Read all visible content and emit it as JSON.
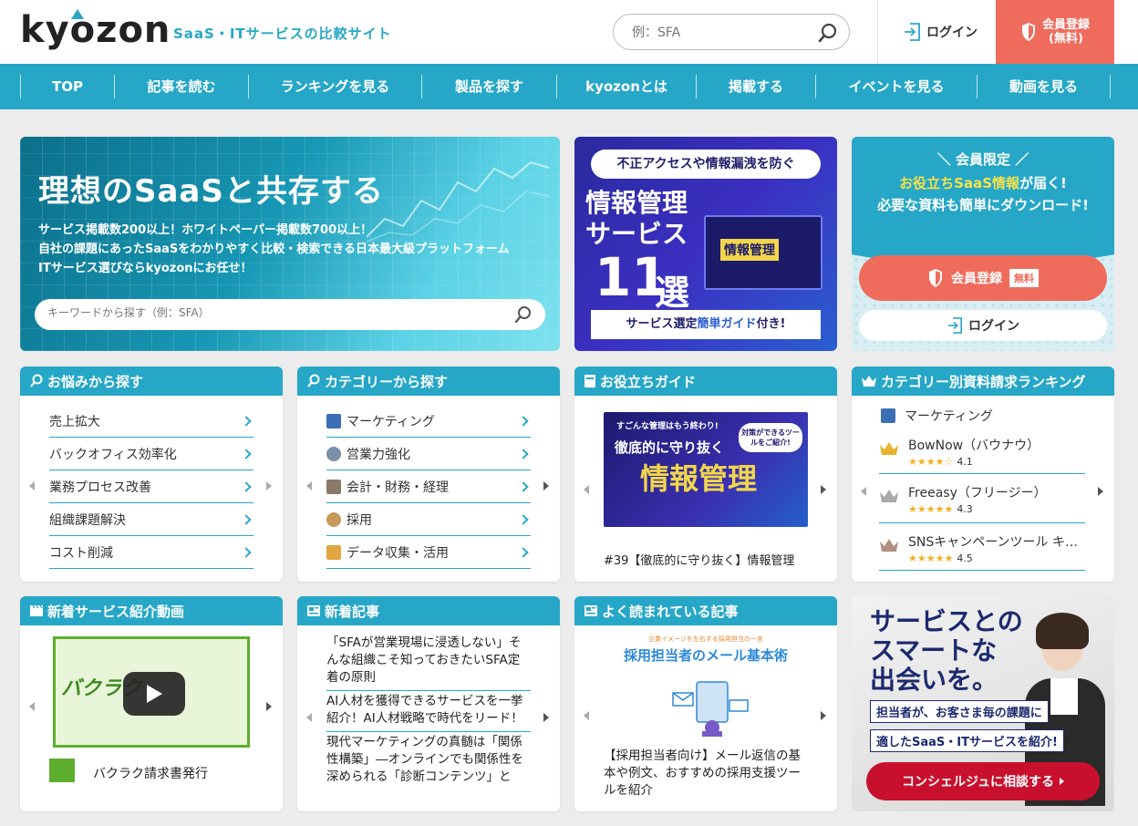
{
  "header": {
    "logo": "kyozon",
    "tagline": "SaaS・ITサービスの比較サイト",
    "search_placeholder": "例：SFA",
    "login_label": "ログイン",
    "register_line1": "会員登録",
    "register_line2": "(無料)"
  },
  "nav": [
    "TOP",
    "記事を読む",
    "ランキングを見る",
    "製品を探す",
    "kyozonとは",
    "掲載する",
    "イベントを見る",
    "動画を見る"
  ],
  "hero": {
    "title": "理想のSaaSと共存する",
    "line1": "サービス掲載数200以上！ホワイトペーパー掲載数700以上！",
    "line2": "自社の課題にあったSaaSをわかりやすく比較・検索できる日本最大級プラットフォーム",
    "line3": "ITサービス選びならkyozonにお任せ！",
    "search_placeholder": "キーワードから探す（例：SFA）"
  },
  "banner_guide": {
    "pill": "不正アクセスや情報漏洩を防ぐ",
    "title1": "情報管理",
    "title2": "サービス",
    "count": "11",
    "sen": "選",
    "img_label": "情報管理",
    "bottom_pre": "サービス選定",
    "bottom_hl": "簡単ガイド",
    "bottom_post": "付き!"
  },
  "member": {
    "title": "会員限定",
    "sub1_hl": "お役立ちSaaS情報",
    "sub1_rest": "が届く!",
    "sub2": "必要な資料も簡単にダウンロード!",
    "register_label": "会員登録",
    "register_badge": "無料",
    "login_label": "ログイン"
  },
  "worries": {
    "title": "お悩みから探す",
    "items": [
      "売上拡大",
      "バックオフィス効率化",
      "業務プロセス改善",
      "組織課題解決",
      "コスト削減"
    ]
  },
  "categories": {
    "title": "カテゴリーから探す",
    "items": [
      "マーケティング",
      "営業力強化",
      "会計・財務・経理",
      "採用",
      "データ収集・活用"
    ]
  },
  "guide": {
    "title": "お役立ちガイド",
    "img_top": "すごんな管理はもう終わり!",
    "img_mid": "徹底的に守り抜く",
    "img_main": "情報管理",
    "img_bubble": "対策ができるツールをご紹介!",
    "caption": "#39【徹底的に守り抜く】情報管理"
  },
  "ranking": {
    "title": "カテゴリー別資料請求ランキング",
    "category": "マーケティング",
    "items": [
      {
        "name": "BowNow（バウナウ）",
        "score": "4.1",
        "stars": "★★★★☆"
      },
      {
        "name": "Freeasy（フリージー）",
        "score": "4.3",
        "stars": "★★★★★"
      },
      {
        "name": "SNSキャンペーンツール キ…",
        "score": "4.5",
        "stars": "★★★★★"
      }
    ]
  },
  "video": {
    "title": "新着サービス紹介動画",
    "thumb_text": "バクラク",
    "caption": "バクラク請求書発行"
  },
  "news": {
    "title": "新着記事",
    "items": [
      "「SFAが営業現場に浸透しない」そんな組織こそ知っておきたいSFA定着の原則",
      "AI人材を獲得できるサービスを一挙紹介！AI人材戦略で時代をリード！",
      "現代マーケティングの真髄は「関係性構築」―オンラインでも関係性を深められる「診断コンテンツ」と"
    ]
  },
  "popular": {
    "title": "よく読まれている記事",
    "img_small": "企業イメージを左右する採用担当の一言",
    "img_title": "採用担当者のメール基本術",
    "caption": "【採用担当者向け】メール返信の基本や例文、おすすめの採用支援ツールを紹介"
  },
  "concierge": {
    "title1": "サービスとの",
    "title2": "スマートな",
    "title3": "出会いを。",
    "tag1": "担当者が、お客さま毎の課題に",
    "tag2": "適したSaaS・ITサービスを紹介!",
    "button": "コンシェルジュに相談する"
  },
  "colors": {
    "accent": "#27a7c7",
    "register": "#ef6b5c",
    "concierge_button": "#c8102e"
  }
}
